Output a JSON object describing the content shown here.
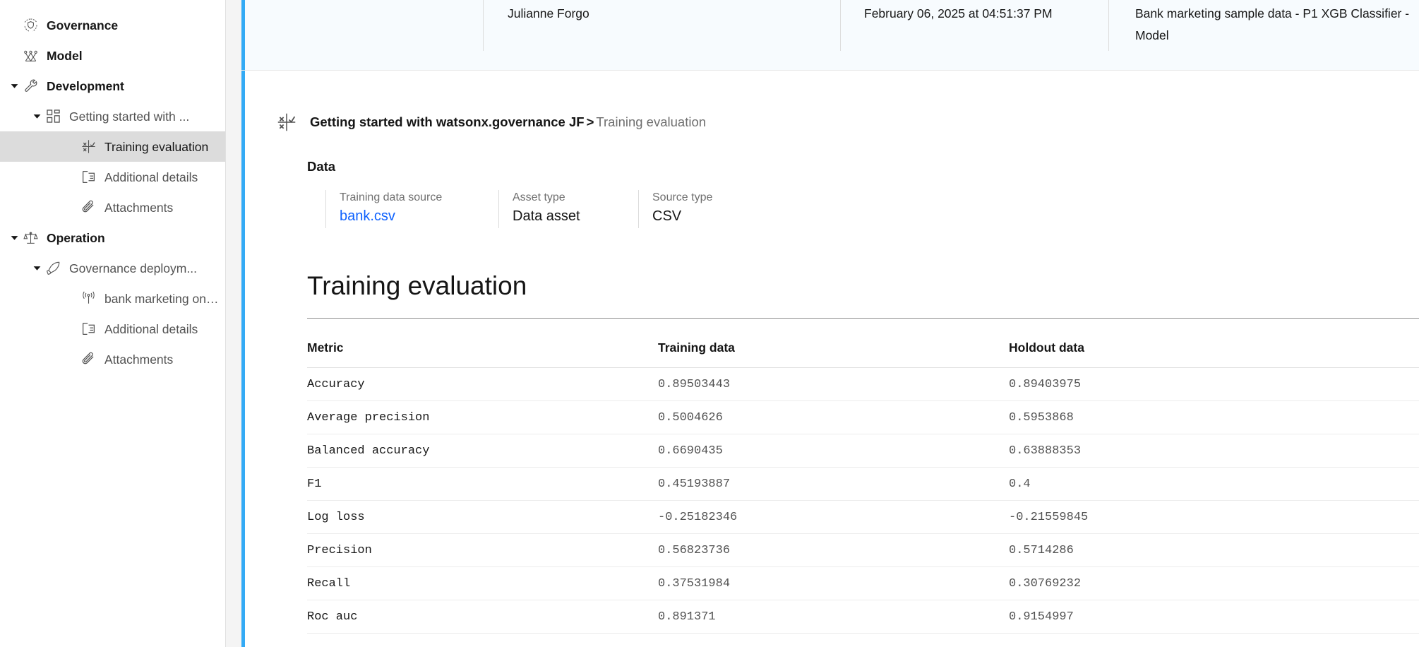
{
  "sidebar": {
    "items": [
      {
        "label": "Governance",
        "icon": "governance-shield-icon",
        "level": 0,
        "bold": true,
        "caret": "none",
        "active": false
      },
      {
        "label": "Model",
        "icon": "model-graph-icon",
        "level": 0,
        "bold": true,
        "caret": "none",
        "active": false
      },
      {
        "label": "Development",
        "icon": "wrench-icon",
        "level": 0,
        "bold": true,
        "caret": "down",
        "active": false
      },
      {
        "label": "Getting started with ...",
        "icon": "dashboard-grid-icon",
        "level": 1,
        "bold": false,
        "caret": "down",
        "active": false
      },
      {
        "label": "Training evaluation",
        "icon": "model-evaluation-icon",
        "level": 2,
        "bold": false,
        "caret": "none",
        "active": true
      },
      {
        "label": "Additional details",
        "icon": "document-details-icon",
        "level": 2,
        "bold": false,
        "caret": "none",
        "active": false
      },
      {
        "label": "Attachments",
        "icon": "paperclip-icon",
        "level": 2,
        "bold": false,
        "caret": "none",
        "active": false
      },
      {
        "label": "Operation",
        "icon": "scales-balance-icon",
        "level": 0,
        "bold": true,
        "caret": "down",
        "active": false
      },
      {
        "label": "Governance deploym...",
        "icon": "rocket-icon",
        "level": 1,
        "bold": false,
        "caret": "down",
        "active": false
      },
      {
        "label": "bank marketing onlin..",
        "icon": "broadcast-signal-icon",
        "level": 2,
        "bold": false,
        "caret": "none",
        "active": false
      },
      {
        "label": "Additional details",
        "icon": "document-details-icon",
        "level": 2,
        "bold": false,
        "caret": "none",
        "active": false
      },
      {
        "label": "Attachments",
        "icon": "paperclip-icon",
        "level": 2,
        "bold": false,
        "caret": "none",
        "active": false
      }
    ]
  },
  "top_card": {
    "owner": "Julianne Forgo",
    "timestamp": "February 06, 2025 at 04:51:37 PM",
    "asset": "Bank marketing sample data - P1 XGB Classifier - Model",
    "accent_color": "#33aaf5",
    "background_color": "#f7fbfe"
  },
  "breadcrumb": {
    "icon": "model-evaluation-icon",
    "parent": "Getting started with watsonx.governance JF",
    "separator": ">",
    "current": "Training evaluation"
  },
  "data_section": {
    "heading": "Data",
    "cards": [
      {
        "label": "Training data source",
        "value": "bank.csv",
        "is_link": true
      },
      {
        "label": "Asset type",
        "value": "Data asset",
        "is_link": false
      },
      {
        "label": "Source type",
        "value": "CSV",
        "is_link": false
      }
    ]
  },
  "page": {
    "title": "Training evaluation"
  },
  "chart_data": {
    "type": "table",
    "title": "Training evaluation",
    "columns": [
      "Metric",
      "Training data",
      "Holdout data"
    ],
    "rows": [
      {
        "metric": "Accuracy",
        "training": "0.89503443",
        "holdout": "0.89403975"
      },
      {
        "metric": "Average precision",
        "training": "0.5004626",
        "holdout": "0.5953868"
      },
      {
        "metric": "Balanced accuracy",
        "training": "0.6690435",
        "holdout": "0.63888353"
      },
      {
        "metric": "F1",
        "training": "0.45193887",
        "holdout": "0.4"
      },
      {
        "metric": "Log loss",
        "training": "-0.25182346",
        "holdout": "-0.21559845"
      },
      {
        "metric": "Precision",
        "training": "0.56823736",
        "holdout": "0.5714286"
      },
      {
        "metric": "Recall",
        "training": "0.37531984",
        "holdout": "0.30769232"
      },
      {
        "metric": "Roc auc",
        "training": "0.891371",
        "holdout": "0.9154997"
      }
    ]
  }
}
